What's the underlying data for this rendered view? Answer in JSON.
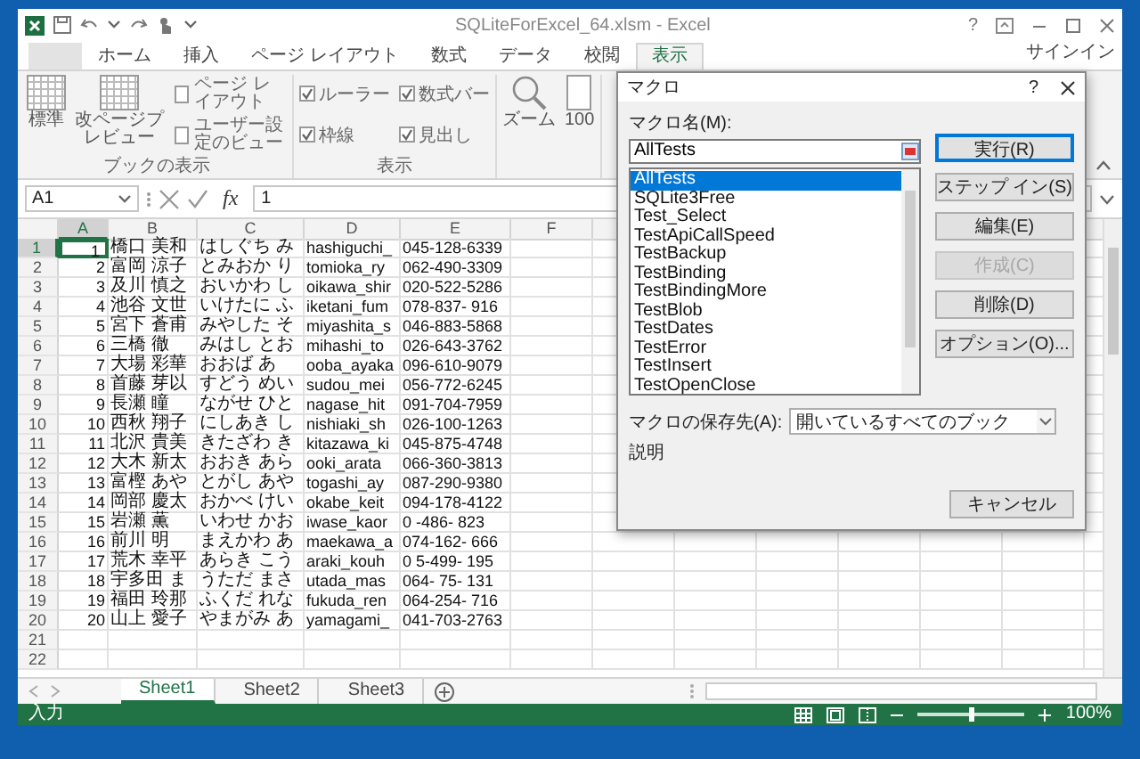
{
  "window": {
    "title": "SQLiteForExcel_64.xlsm - Excel",
    "help": "?",
    "signin": "サインイン"
  },
  "ribbon_tabs": [
    {
      "kind": "file",
      "selected": false
    },
    {
      "kind": "tab",
      "label": "ホーム",
      "selected": false
    },
    {
      "kind": "tab",
      "label": "挿入",
      "selected": false
    },
    {
      "kind": "tab",
      "label": "ページ レイアウト",
      "selected": false
    },
    {
      "kind": "tab",
      "label": "数式",
      "selected": false
    },
    {
      "kind": "tab",
      "label": "データ",
      "selected": false
    },
    {
      "kind": "tab",
      "label": "校閲",
      "selected": false
    },
    {
      "kind": "tab",
      "label": "表示",
      "selected": true
    }
  ],
  "ribbon": {
    "groups": [
      {
        "label": "ブックの表示",
        "items": [
          {
            "kind": "sheet",
            "label": "標準"
          },
          {
            "kind": "sheet",
            "label": "改ページプレビュー"
          },
          {
            "kind": "small",
            "label": "ページ レイアウト"
          },
          {
            "kind": "small",
            "label": "ユーザー設定のビュー"
          }
        ]
      },
      {
        "label": "表示",
        "items": [
          {
            "kind": "check",
            "label": "ルーラー",
            "checked": true
          },
          {
            "kind": "check",
            "label": "枠線",
            "checked": true
          },
          {
            "kind": "check",
            "label": "数式バー",
            "checked": true
          },
          {
            "kind": "check",
            "label": "見出し",
            "checked": true
          }
        ]
      },
      {
        "items": [
          {
            "kind": "zoom",
            "label": "ズーム"
          },
          {
            "kind": "page",
            "label": "100"
          }
        ]
      }
    ]
  },
  "formula_bar": {
    "name_box": "A1",
    "function_label": "fx",
    "value": "1"
  },
  "sheet": {
    "columns": [
      {
        "label": "A",
        "selected": true
      },
      {
        "label": "B",
        "selected": false
      },
      {
        "label": "C",
        "selected": false
      },
      {
        "label": "D",
        "selected": false
      },
      {
        "label": "E",
        "selected": false
      },
      {
        "label": "F",
        "selected": false
      }
    ],
    "rows": [
      {
        "number": "1",
        "selected": true,
        "cells": [
          "1",
          "橋口 美和",
          "はしぐち み",
          "hashiguchi_",
          "045-128-6339"
        ]
      },
      {
        "number": "2",
        "selected": false,
        "cells": [
          "2",
          "富岡 涼子",
          "とみおか り",
          "tomioka_ry",
          "062-490-3309"
        ]
      },
      {
        "number": "3",
        "selected": false,
        "cells": [
          "3",
          "及川 慎之",
          "おいかわ し",
          "oikawa_shir",
          "020-522-5286"
        ]
      },
      {
        "number": "4",
        "selected": false,
        "cells": [
          "4",
          "池谷 文世",
          "いけたに ふ",
          "iketani_fum",
          "078-837- 916"
        ]
      },
      {
        "number": "5",
        "selected": false,
        "cells": [
          "5",
          "宮下 蒼甫",
          "みやした そ",
          "miyashita_s",
          "046-883-5868"
        ]
      },
      {
        "number": "6",
        "selected": false,
        "cells": [
          "6",
          "三橋 徹",
          "みはし とお",
          "mihashi_to",
          "026-643-3762"
        ]
      },
      {
        "number": "7",
        "selected": false,
        "cells": [
          "7",
          "大場 彩華",
          "おおば あ",
          "ooba_ayaka",
          "096-610-9079"
        ]
      },
      {
        "number": "8",
        "selected": false,
        "cells": [
          "8",
          "首藤 芽以",
          "すどう めい",
          "sudou_mei",
          "056-772-6245"
        ]
      },
      {
        "number": "9",
        "selected": false,
        "cells": [
          "9",
          "長瀬 瞳",
          "ながせ ひと",
          "nagase_hit",
          "091-704-7959"
        ]
      },
      {
        "number": "10",
        "selected": false,
        "cells": [
          "10",
          "西秋 翔子",
          "にしあき し",
          "nishiaki_sh",
          "026-100-1263"
        ]
      },
      {
        "number": "11",
        "selected": false,
        "cells": [
          "11",
          "北沢 貴美",
          "きたざわ き",
          "kitazawa_ki",
          "045-875-4748"
        ]
      },
      {
        "number": "12",
        "selected": false,
        "cells": [
          "12",
          "大木 新太",
          "おおき あら",
          "ooki_arata",
          "066-360-3813"
        ]
      },
      {
        "number": "13",
        "selected": false,
        "cells": [
          "13",
          "富樫 あや",
          "とがし あや",
          "togashi_ay",
          "087-290-9380"
        ]
      },
      {
        "number": "14",
        "selected": false,
        "cells": [
          "14",
          "岡部 慶太",
          "おかべ けい",
          "okabe_keit",
          "094-178-4122"
        ]
      },
      {
        "number": "15",
        "selected": false,
        "cells": [
          "15",
          "岩瀬 薫",
          "いわせ かお",
          "iwase_kaor",
          "0 -486- 823"
        ]
      },
      {
        "number": "16",
        "selected": false,
        "cells": [
          "16",
          "前川 明",
          "まえかわ あ",
          "maekawa_a",
          "074-162- 666"
        ]
      },
      {
        "number": "17",
        "selected": false,
        "cells": [
          "17",
          "荒木 幸平",
          "あらき こう",
          "araki_kouh",
          "0 5-499- 195"
        ]
      },
      {
        "number": "18",
        "selected": false,
        "cells": [
          "18",
          "宇多田 ま",
          "うただ まさ",
          "utada_mas",
          "064- 75- 131"
        ]
      },
      {
        "number": "19",
        "selected": false,
        "cells": [
          "19",
          "福田 玲那",
          "ふくだ れな",
          "fukuda_ren",
          "064-254- 716"
        ]
      },
      {
        "number": "20",
        "selected": false,
        "cells": [
          "20",
          "山上 愛子",
          "やまがみ あ",
          "yamagami_",
          "041-703-2763"
        ]
      },
      {
        "number": "21",
        "selected": false
      },
      {
        "number": "22",
        "selected": false
      }
    ]
  },
  "sheet_tabs": [
    {
      "label": "Sheet1",
      "selected": true
    },
    {
      "label": "Sheet2",
      "selected": false
    },
    {
      "label": "Sheet3",
      "selected": false
    }
  ],
  "status_bar": {
    "mode": "入力",
    "zoom_slider": {
      "level": 0.5
    },
    "zoom": "100%"
  },
  "dialog": {
    "title": "マクロ",
    "help": "?",
    "name_label": "マクロ名(M):",
    "name_value": "AllTests",
    "macros": [
      {
        "name": "AllTests",
        "selected": true
      },
      {
        "name": "SQLite3Free",
        "selected": false
      },
      {
        "name": "Test_Select",
        "selected": false
      },
      {
        "name": "TestApiCallSpeed",
        "selected": false
      },
      {
        "name": "TestBackup",
        "selected": false
      },
      {
        "name": "TestBinding",
        "selected": false
      },
      {
        "name": "TestBindingMore",
        "selected": false
      },
      {
        "name": "TestBlob",
        "selected": false
      },
      {
        "name": "TestDates",
        "selected": false
      },
      {
        "name": "TestError",
        "selected": false
      },
      {
        "name": "TestInsert",
        "selected": false
      },
      {
        "name": "TestOpenClose",
        "selected": false
      }
    ],
    "buttons": [
      {
        "label": "実行(R)",
        "default": true,
        "disabled": false
      },
      {
        "label": "ステップ イン(S)",
        "default": false,
        "disabled": false
      },
      {
        "label": "編集(E)",
        "default": false,
        "disabled": false
      },
      {
        "label": "作成(C)",
        "default": false,
        "disabled": true
      },
      {
        "label": "削除(D)",
        "default": false,
        "disabled": false
      },
      {
        "label": "オプション(O)...",
        "default": false,
        "disabled": false
      }
    ],
    "location_label": "マクロの保存先(A):",
    "location_value": "開いているすべてのブック",
    "description_label": "説明",
    "cancel": "キャンセル"
  }
}
